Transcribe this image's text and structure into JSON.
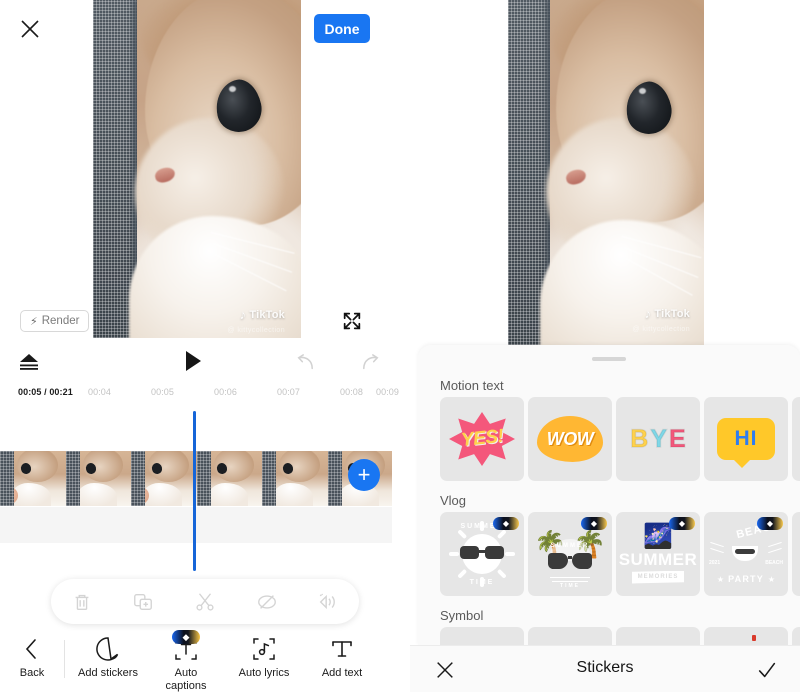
{
  "app": {
    "left_panel": {
      "close_icon": "close-icon",
      "done_label": "Done",
      "render_label": "Render",
      "render_icon": "bolt-icon",
      "fullscreen_icon": "expand-icon",
      "watermark": "TikTok",
      "watermark_sub": "@ kittycollection",
      "transport": {
        "eject_icon": "eject-icon",
        "play_icon": "play-icon",
        "undo_icon": "undo-arrow-icon",
        "redo_icon": "redo-arrow-icon"
      },
      "ruler": {
        "current": "00:05 / 00:21",
        "ticks": [
          "00:04",
          "00:05",
          "00:06",
          "00:07",
          "00:08",
          "00:09"
        ]
      },
      "timeline": {
        "add_clip_label": "+",
        "frame_count": 6
      },
      "float_actions": [
        {
          "name": "delete-icon",
          "label": "Delete"
        },
        {
          "name": "copy-icon",
          "label": "Copy"
        },
        {
          "name": "split-icon",
          "label": "Split"
        },
        {
          "name": "hide-icon",
          "label": "Hide"
        },
        {
          "name": "volume-icon",
          "label": "Volume"
        }
      ],
      "bottom_nav": [
        {
          "name": "back",
          "label": "Back",
          "icon": "chevron-left-icon",
          "pro": false
        },
        {
          "name": "add-stickers",
          "label": "Add stickers",
          "icon": "sticker-icon",
          "pro": false
        },
        {
          "name": "auto-captions",
          "label": "Auto\ncaptions",
          "label_line1": "Auto",
          "label_line2": "captions",
          "icon": "captions-icon",
          "pro": true
        },
        {
          "name": "auto-lyrics",
          "label": "Auto lyrics",
          "icon": "lyrics-icon",
          "pro": false
        },
        {
          "name": "add-text",
          "label": "Add text",
          "icon": "text-icon",
          "pro": false
        }
      ]
    },
    "right_panel": {
      "sections": [
        {
          "title": "Motion text",
          "items": [
            {
              "label": "YES!",
              "pro": false
            },
            {
              "label": "WOW",
              "pro": false
            },
            {
              "label": "BYE",
              "pro": false
            },
            {
              "label": "HI",
              "pro": false
            },
            {
              "label": "",
              "pro": false
            }
          ]
        },
        {
          "title": "Vlog",
          "items": [
            {
              "label": "SUMMER TIME",
              "arc_top": "SUMMER",
              "arc_bottom": "TIME",
              "pro": true
            },
            {
              "label": "SUMMER TIME",
              "arc_top": "SUMMER",
              "arc_bottom": "TIME",
              "pro": true
            },
            {
              "label": "SUMMER",
              "ribbon": "MEMORIES",
              "pro": true
            },
            {
              "label": "BEACH PARTY",
              "top": "BEACH",
              "bottom": "PARTY",
              "year": "2021",
              "right": "BEACH",
              "pro": true
            },
            {
              "label": "",
              "pro": false
            }
          ]
        },
        {
          "title": "Symbol",
          "items": [
            {
              "label": "",
              "pro": false
            },
            {
              "label": "",
              "pro": false
            },
            {
              "label": "",
              "pro": false
            },
            {
              "label": "",
              "pro": false
            },
            {
              "label": "",
              "pro": false
            }
          ]
        }
      ],
      "footer": {
        "cancel_icon": "close-icon",
        "title": "Stickers",
        "confirm_icon": "check-icon"
      },
      "pro_badge_text": "◆"
    },
    "colors": {
      "accent_blue": "#1976f2",
      "playhead_blue": "#1565d8",
      "tile_grey": "#e6e6e6",
      "sheet_bg": "#fafafa",
      "tick_grey": "#c3c3c3"
    }
  }
}
